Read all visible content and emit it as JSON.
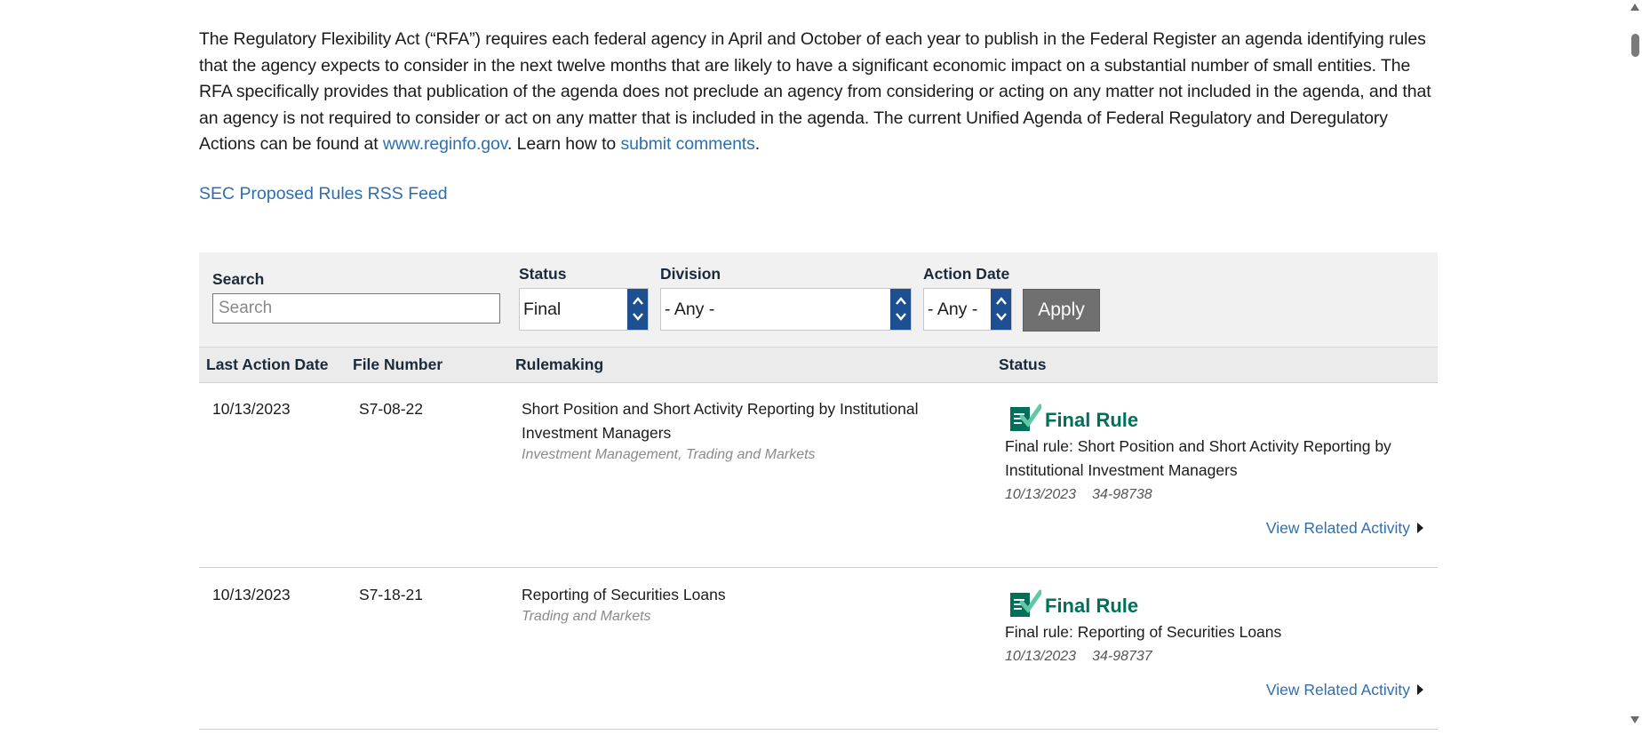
{
  "intro": {
    "text_before_link": "The Regulatory Flexibility Act (“RFA”) requires each federal agency in April and October of each year to publish in the Federal Register an agenda identifying rules that the agency expects to consider in the next twelve months that are likely to have a significant economic impact on a substantial number of small entities. The RFA specifically provides that publication of the agenda does not preclude an agency from considering or acting on any matter not included in the agenda, and that an agency is not required to consider or act on any matter that is included in the agenda. The current Unified Agenda of Federal Regulatory and Deregulatory Actions can be found at",
    "reginfo_link": "www.reginfo.gov",
    "text_middle": ". Learn how to",
    "comments_link": "submit comments",
    "text_end": "."
  },
  "rss_link": "SEC Proposed Rules RSS Feed",
  "filters": {
    "search_label": "Search",
    "search_placeholder": "Search",
    "status_label": "Status",
    "status_value": "Final",
    "division_label": "Division",
    "division_value": "- Any -",
    "action_date_label": "Action Date",
    "action_date_value": "- Any -",
    "apply_label": "Apply"
  },
  "columns": {
    "last_action_date": "Last Action Date",
    "file_number": "File Number",
    "rulemaking": "Rulemaking",
    "status": "Status"
  },
  "rows": [
    {
      "date": "10/13/2023",
      "file_number": "S7-08-22",
      "title": "Short Position and Short Activity Reporting by Institutional Investment Managers",
      "division": "Investment Management, Trading and Markets",
      "status_label": "Final Rule",
      "status_desc": "Final rule: Short Position and Short Activity Reporting by Institutional Investment Managers",
      "status_date": "10/13/2023",
      "release_no": "34-98738",
      "related_link": "View Related Activity"
    },
    {
      "date": "10/13/2023",
      "file_number": "S7-18-21",
      "title": "Reporting of Securities Loans",
      "division": "Trading and Markets",
      "status_label": "Final Rule",
      "status_desc": "Final rule: Reporting of Securities Loans",
      "status_date": "10/13/2023",
      "release_no": "34-98737",
      "related_link": "View Related Activity"
    }
  ],
  "colors": {
    "link": "#2e6fb0",
    "status_green": "#00705b",
    "spinner_blue": "#1d4f91",
    "apply_gray": "#707070"
  },
  "icons": {
    "status": "final-rule-document-check-icon",
    "caret": "caret-right-icon",
    "spinner": "up-down-chevron-icon"
  }
}
